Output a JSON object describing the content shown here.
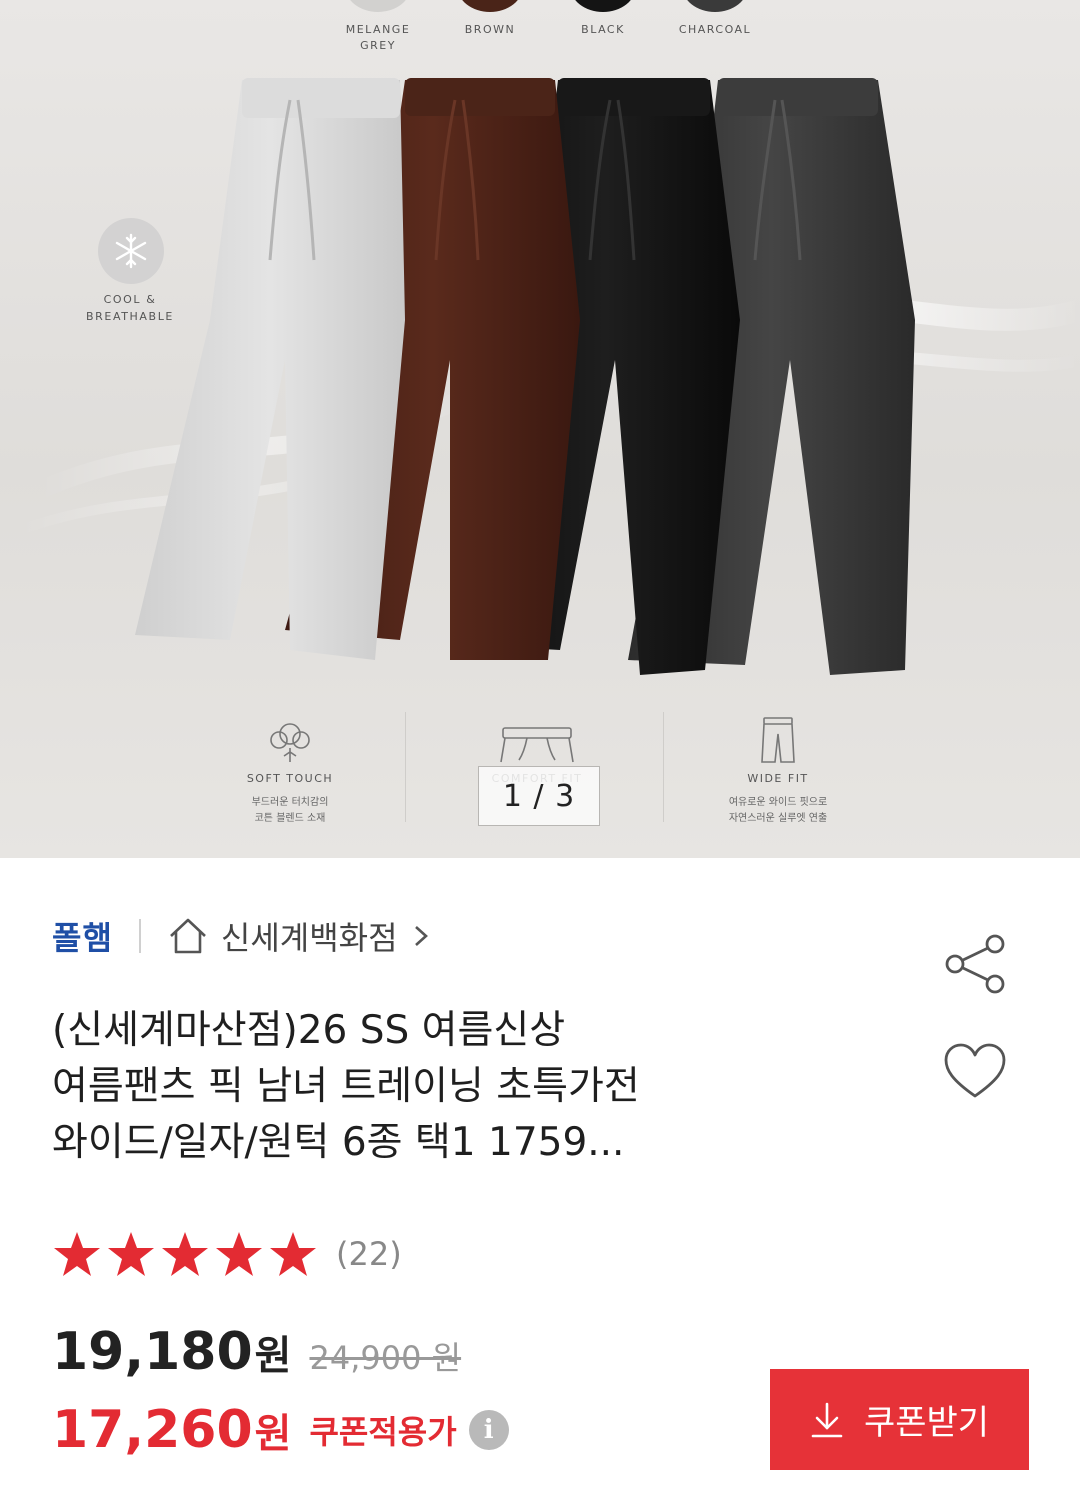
{
  "hero": {
    "swatches": [
      {
        "label": "MELANGE\nGREY",
        "color": "#d9d8d6"
      },
      {
        "label": "BROWN",
        "color": "#4a2418"
      },
      {
        "label": "BLACK",
        "color": "#141414"
      },
      {
        "label": "CHARCOAL",
        "color": "#3b3b3b"
      }
    ],
    "cool_label": "COOL &\nBREATHABLE",
    "features": [
      {
        "title": "SOFT TOUCH",
        "desc": "부드러운 터치감의\n코튼 블렌드 소재",
        "icon": "cotton-icon"
      },
      {
        "title": "COMFORT FIT",
        "desc": "",
        "icon": "pants-outline-icon"
      },
      {
        "title": "WIDE FIT",
        "desc": "여유로운 와이드 핏으로\n자연스러운 실루엣 연출",
        "icon": "wide-pants-icon"
      }
    ],
    "counter": "1 / 3"
  },
  "brand": {
    "name": "폴햄",
    "store": "신세계백화점",
    "store_icon": "home-icon"
  },
  "product": {
    "title_lines": [
      "(신세계마산점)26 SS 여름신상",
      "여름팬츠 픽 남녀 트레이닝 초특가전",
      "와이드/일자/원턱 6종 택1 1759..."
    ],
    "rating": 5,
    "review_count": "(22)",
    "price": "19,180",
    "price_unit": "원",
    "original_price": "24,900 원",
    "coupon_price": "17,260",
    "coupon_unit": "원",
    "coupon_note": "쿠폰적용가",
    "coupon_button": "쿠폰받기"
  },
  "colors": {
    "brand_blue": "#1f4fa6",
    "accent_red": "#e32b33",
    "button_red": "#e63238"
  }
}
